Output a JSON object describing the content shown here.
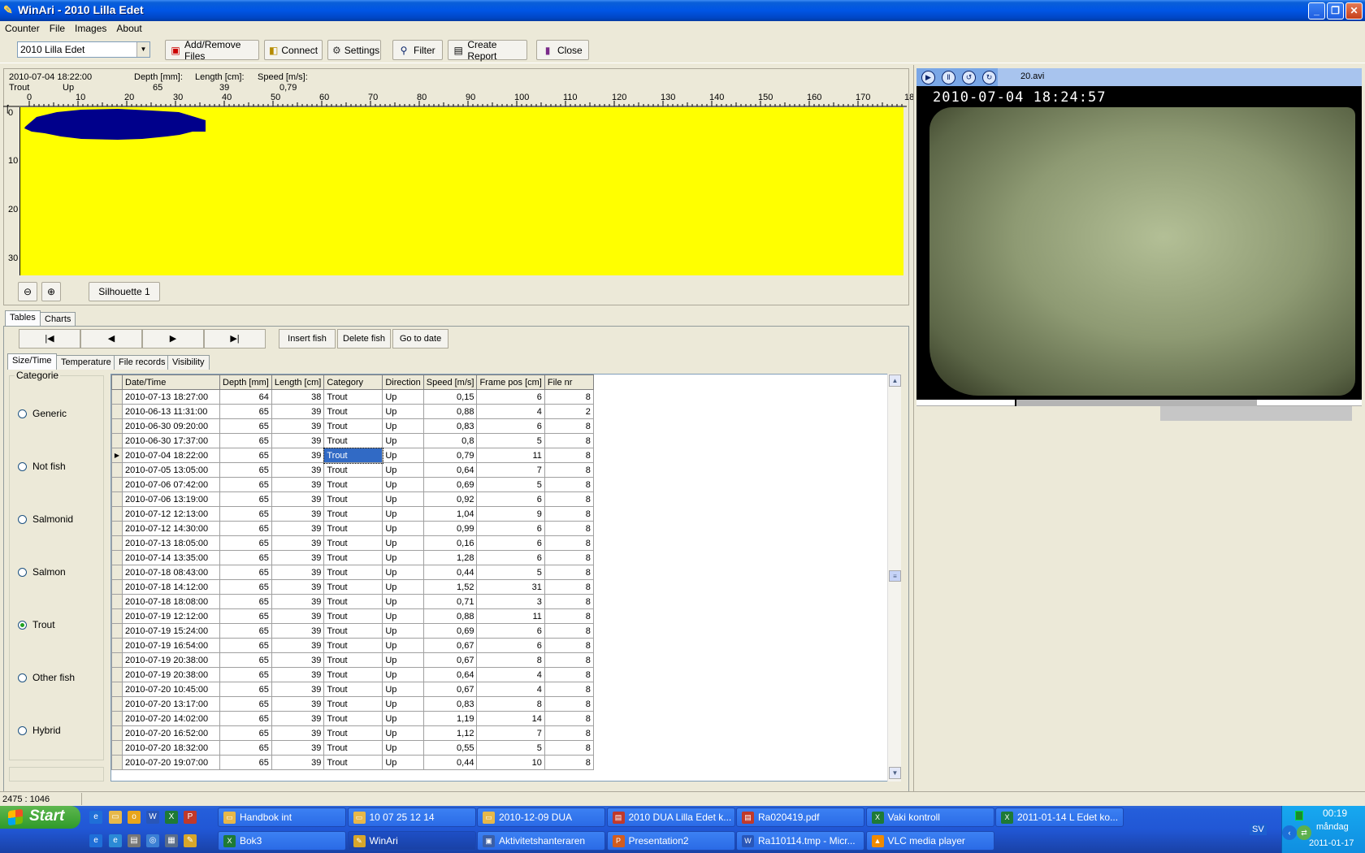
{
  "window": {
    "title": "WinAri - 2010 Lilla Edet"
  },
  "menu": [
    "Counter",
    "File",
    "Images",
    "About"
  ],
  "toolbar": {
    "combo_value": "2010 Lilla Edet",
    "buttons": [
      "Add/Remove Files",
      "Connect",
      "Settings",
      "Filter",
      "Create Report",
      "Close"
    ]
  },
  "silhouette": {
    "date": "2010-07-04 18:22:00",
    "category": "Trout",
    "direction": "Up",
    "depth_label": "Depth [mm]:",
    "depth_value": "65",
    "length_label": "Length [cm]:",
    "length_value": "39",
    "speed_label": "Speed [m/s]:",
    "speed_value": "0,79",
    "x_ticks": [
      "0",
      "10",
      "20",
      "30",
      "40",
      "50",
      "60",
      "70",
      "80",
      "90",
      "100",
      "110",
      "120",
      "130",
      "140",
      "150",
      "160",
      "170",
      "18"
    ],
    "y_ticks": [
      "0",
      "10",
      "20",
      "30"
    ],
    "button_label": "Silhouette 1"
  },
  "tabs": {
    "main": [
      "Tables",
      "Charts"
    ],
    "sub": [
      "Size/Time",
      "Temperature",
      "File records",
      "Visibility"
    ]
  },
  "actions": [
    "Insert fish",
    "Delete fish",
    "Go to date"
  ],
  "nav": [
    "|◀",
    "◀",
    "▶",
    "▶|"
  ],
  "categories": {
    "legend": "Categorie",
    "items": [
      "Generic",
      "Not fish",
      "Salmonid",
      "Salmon",
      "Trout",
      "Other fish",
      "Hybrid"
    ],
    "selected": "Trout"
  },
  "table": {
    "columns": [
      "Date/Time",
      "Depth [mm]",
      "Length [cm]",
      "Category",
      "Direction",
      "Speed [m/s]",
      "Frame pos [cm]",
      "File nr"
    ],
    "rows": [
      [
        "2010-07-13 18:27:00",
        "64",
        "38",
        "Trout",
        "Up",
        "0,15",
        "6",
        "8"
      ],
      [
        "2010-06-13 11:31:00",
        "65",
        "39",
        "Trout",
        "Up",
        "0,88",
        "4",
        "2"
      ],
      [
        "2010-06-30 09:20:00",
        "65",
        "39",
        "Trout",
        "Up",
        "0,83",
        "6",
        "8"
      ],
      [
        "2010-06-30 17:37:00",
        "65",
        "39",
        "Trout",
        "Up",
        "0,8",
        "5",
        "8"
      ],
      [
        "2010-07-04 18:22:00",
        "65",
        "39",
        "Trout",
        "Up",
        "0,79",
        "11",
        "8"
      ],
      [
        "2010-07-05 13:05:00",
        "65",
        "39",
        "Trout",
        "Up",
        "0,64",
        "7",
        "8"
      ],
      [
        "2010-07-06 07:42:00",
        "65",
        "39",
        "Trout",
        "Up",
        "0,69",
        "5",
        "8"
      ],
      [
        "2010-07-06 13:19:00",
        "65",
        "39",
        "Trout",
        "Up",
        "0,92",
        "6",
        "8"
      ],
      [
        "2010-07-12 12:13:00",
        "65",
        "39",
        "Trout",
        "Up",
        "1,04",
        "9",
        "8"
      ],
      [
        "2010-07-12 14:30:00",
        "65",
        "39",
        "Trout",
        "Up",
        "0,99",
        "6",
        "8"
      ],
      [
        "2010-07-13 18:05:00",
        "65",
        "39",
        "Trout",
        "Up",
        "0,16",
        "6",
        "8"
      ],
      [
        "2010-07-14 13:35:00",
        "65",
        "39",
        "Trout",
        "Up",
        "1,28",
        "6",
        "8"
      ],
      [
        "2010-07-18 08:43:00",
        "65",
        "39",
        "Trout",
        "Up",
        "0,44",
        "5",
        "8"
      ],
      [
        "2010-07-18 14:12:00",
        "65",
        "39",
        "Trout",
        "Up",
        "1,52",
        "31",
        "8"
      ],
      [
        "2010-07-18 18:08:00",
        "65",
        "39",
        "Trout",
        "Up",
        "0,71",
        "3",
        "8"
      ],
      [
        "2010-07-19 12:12:00",
        "65",
        "39",
        "Trout",
        "Up",
        "0,88",
        "11",
        "8"
      ],
      [
        "2010-07-19 15:24:00",
        "65",
        "39",
        "Trout",
        "Up",
        "0,69",
        "6",
        "8"
      ],
      [
        "2010-07-19 16:54:00",
        "65",
        "39",
        "Trout",
        "Up",
        "0,67",
        "6",
        "8"
      ],
      [
        "2010-07-19 20:38:00",
        "65",
        "39",
        "Trout",
        "Up",
        "0,67",
        "8",
        "8"
      ],
      [
        "2010-07-19 20:38:00",
        "65",
        "39",
        "Trout",
        "Up",
        "0,64",
        "4",
        "8"
      ],
      [
        "2010-07-20 10:45:00",
        "65",
        "39",
        "Trout",
        "Up",
        "0,67",
        "4",
        "8"
      ],
      [
        "2010-07-20 13:17:00",
        "65",
        "39",
        "Trout",
        "Up",
        "0,83",
        "8",
        "8"
      ],
      [
        "2010-07-20 14:02:00",
        "65",
        "39",
        "Trout",
        "Up",
        "1,19",
        "14",
        "8"
      ],
      [
        "2010-07-20 16:52:00",
        "65",
        "39",
        "Trout",
        "Up",
        "1,12",
        "7",
        "8"
      ],
      [
        "2010-07-20 18:32:00",
        "65",
        "39",
        "Trout",
        "Up",
        "0,55",
        "5",
        "8"
      ],
      [
        "2010-07-20 19:07:00",
        "65",
        "39",
        "Trout",
        "Up",
        "0,44",
        "10",
        "8"
      ]
    ],
    "selected_row": 4
  },
  "video": {
    "filename": "20.avi",
    "timestamp": "2010-07-04 18:24:57"
  },
  "status": {
    "coords": "2475 : 1046"
  },
  "taskbar": {
    "start_label": "Start",
    "row1": [
      "Handbok int",
      "10 07 25 12 14",
      "2010-12-09 DUA",
      "2010 DUA Lilla Edet k...",
      "Ra020419.pdf",
      "Vaki kontroll",
      "2011-01-14 L Edet ko..."
    ],
    "row2": [
      "Bok3",
      "WinAri",
      "Aktivitetshanteraren",
      "Presentation2",
      "Ra110114.tmp - Micr...",
      "VLC media player"
    ],
    "active": "WinAri",
    "lang": "SV",
    "time": "00:19",
    "day": "måndag",
    "date": "2011-01-17"
  }
}
